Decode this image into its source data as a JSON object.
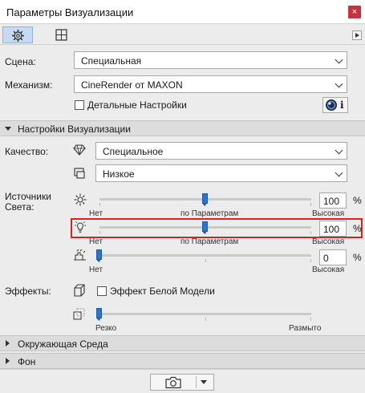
{
  "window": {
    "title": "Параметры Визуализации",
    "close_glyph": "×"
  },
  "tabs": [
    {
      "name": "gear-icon",
      "active": true
    },
    {
      "name": "frame-icon",
      "active": false
    }
  ],
  "scene": {
    "label": "Сцена:",
    "value": "Специальная"
  },
  "engine": {
    "label": "Механизм:",
    "value": "CineRender от MAXON"
  },
  "detailed": {
    "label": "Детальные Настройки",
    "checked": false,
    "info_glyph": "i"
  },
  "render_section": {
    "title": "Настройки Визуализации",
    "expanded": true
  },
  "quality": {
    "label": "Качество:",
    "primary_value": "Специальное",
    "secondary_value": "Низкое"
  },
  "light": {
    "label_line1": "Источники",
    "label_line2": "Света:",
    "sun": {
      "value": "100",
      "unit": "%",
      "level": 0.5,
      "min_label": "Нет",
      "mid_label": "по Параметрам",
      "max_label": "Высокая"
    },
    "lamp": {
      "value": "100",
      "unit": "%",
      "level": 0.5,
      "min_label": "Нет",
      "mid_label": "по Параметрам",
      "max_label": "Высокая"
    },
    "ambient": {
      "value": "0",
      "unit": "%",
      "level": 0.0,
      "min_label": "Нет",
      "max_label": "Высокая"
    }
  },
  "effects": {
    "label": "Эффекты:",
    "white_model": {
      "label": "Эффект Белой Модели",
      "checked": false
    },
    "blur": {
      "level": 0.0,
      "min_label": "Резко",
      "max_label": "Размыто"
    }
  },
  "environment_section": {
    "title": "Окружающая Среда",
    "expanded": false
  },
  "background_section": {
    "title": "Фон",
    "expanded": false
  },
  "bottom": {
    "render_button": "camera-icon"
  },
  "colors": {
    "accent": "#2f72c8",
    "highlight": "#e0201c",
    "close": "#c8323a"
  }
}
